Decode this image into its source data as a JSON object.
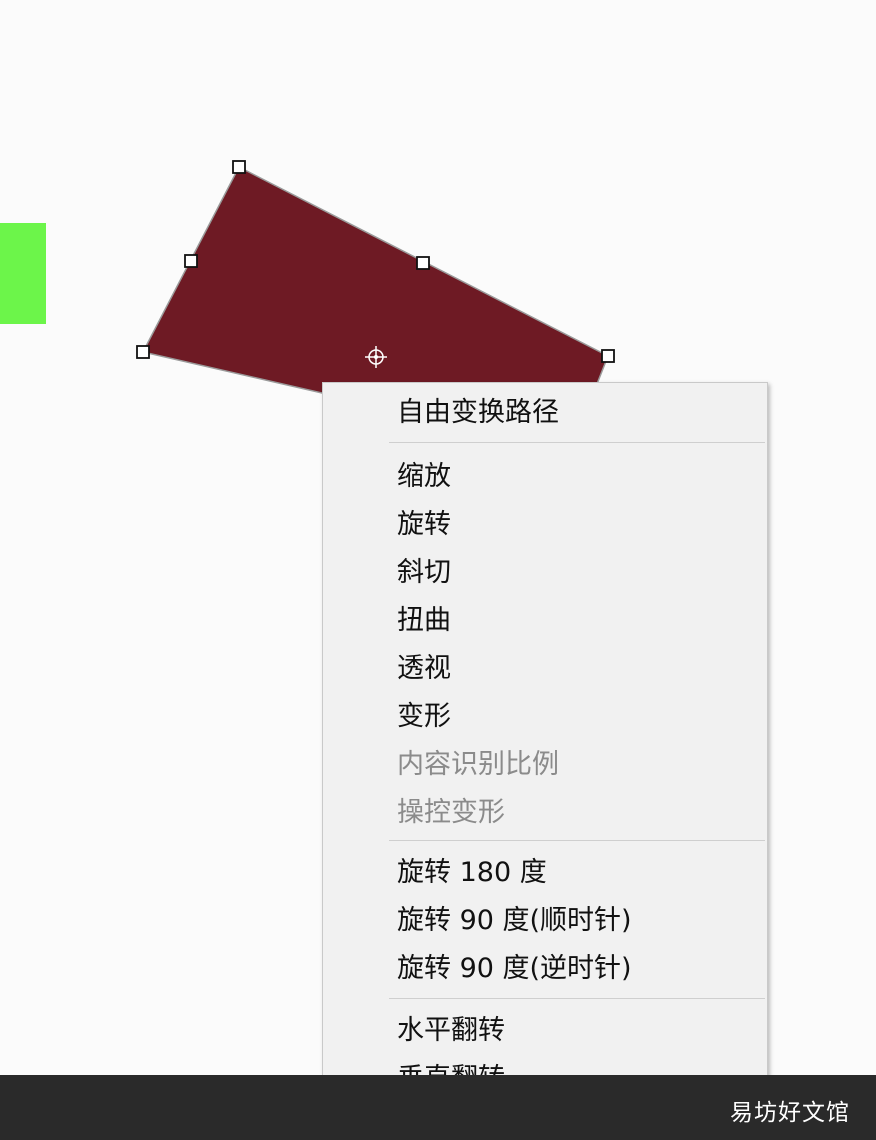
{
  "canvas": {
    "background": "#fbfbfb",
    "swatch_color": "#6cf54a",
    "shape_fill": "#6e1a24",
    "shape_stroke": "#9a9a9a"
  },
  "context_menu": {
    "sections": [
      [
        {
          "label": "自由变换路径",
          "enabled": true
        }
      ],
      [
        {
          "label": "缩放",
          "enabled": true
        },
        {
          "label": "旋转",
          "enabled": true
        },
        {
          "label": "斜切",
          "enabled": true
        },
        {
          "label": "扭曲",
          "enabled": true
        },
        {
          "label": "透视",
          "enabled": true
        },
        {
          "label": "变形",
          "enabled": true
        },
        {
          "label": "内容识别比例",
          "enabled": false
        },
        {
          "label": "操控变形",
          "enabled": false
        }
      ],
      [
        {
          "label": "旋转 180 度",
          "enabled": true
        },
        {
          "label": "旋转 90 度(顺时针)",
          "enabled": true
        },
        {
          "label": "旋转 90 度(逆时针)",
          "enabled": true
        }
      ],
      [
        {
          "label": "水平翻转",
          "enabled": true
        },
        {
          "label": "垂直翻转",
          "enabled": true
        }
      ]
    ]
  },
  "watermark": {
    "text": "易坊好文馆"
  }
}
